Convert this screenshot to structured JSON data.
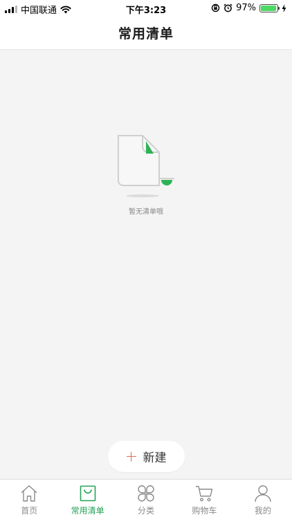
{
  "status_bar": {
    "carrier": "中国联通",
    "time": "下午3:23",
    "battery_percent": "97%",
    "battery_level": 0.97
  },
  "header": {
    "title": "常用清单"
  },
  "empty_state": {
    "message": "暂无清单哦",
    "icon": "empty-document-icon"
  },
  "new_button": {
    "label": "新建",
    "icon": "plus-icon"
  },
  "tab_bar": {
    "items": [
      {
        "label": "首页",
        "icon": "home-icon",
        "active": false
      },
      {
        "label": "常用清单",
        "icon": "shopping-bag-icon",
        "active": true
      },
      {
        "label": "分类",
        "icon": "category-icon",
        "active": false
      },
      {
        "label": "购物车",
        "icon": "cart-icon",
        "active": false
      },
      {
        "label": "我的",
        "icon": "user-icon",
        "active": false
      }
    ]
  },
  "colors": {
    "accent": "#22a355",
    "plus": "#e06a5a",
    "background": "#f4f4f4"
  }
}
